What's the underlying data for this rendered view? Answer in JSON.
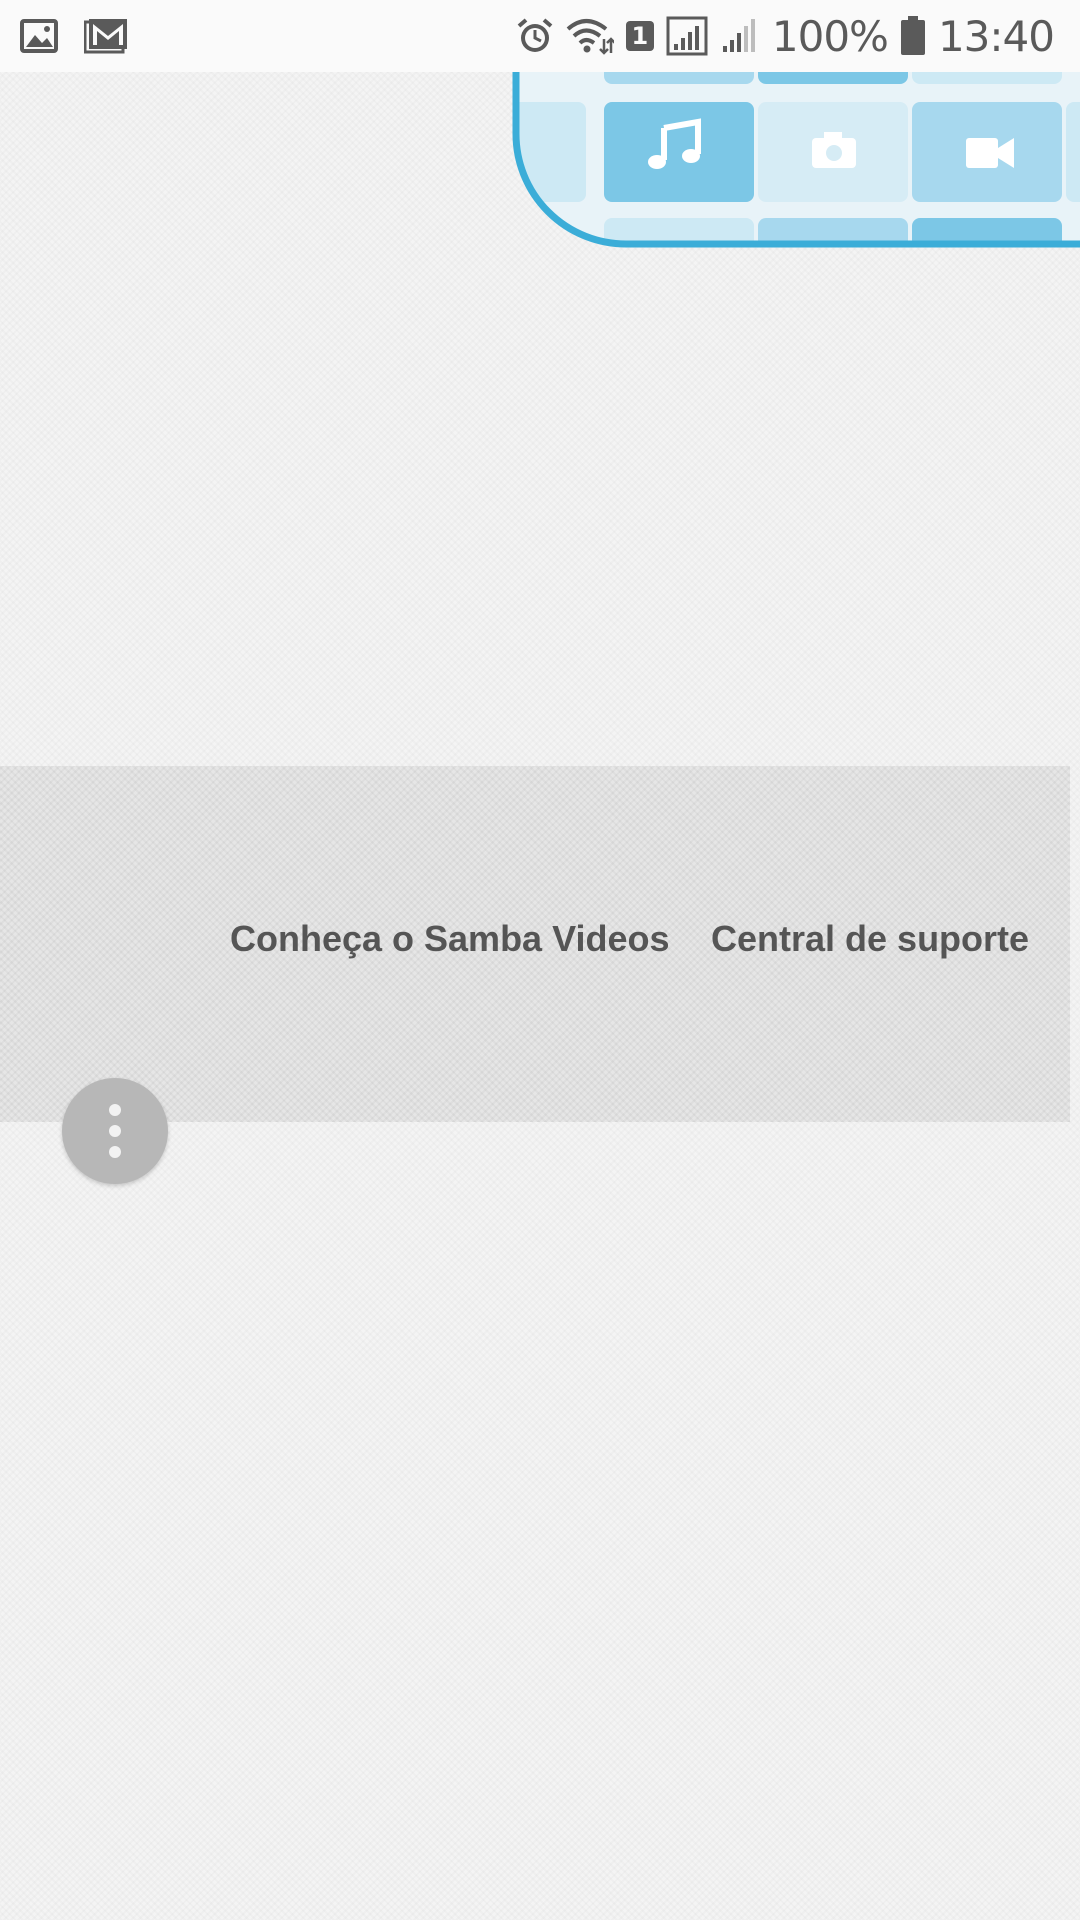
{
  "status_bar": {
    "notification_icons": [
      "gallery-icon",
      "gmail-icon"
    ],
    "system_icons": [
      "alarm-icon",
      "wifi-icon",
      "sim-1-icon",
      "signal-icon",
      "signal-weak-icon",
      "battery-icon"
    ],
    "sim_number": "1",
    "battery_percent": "100%",
    "time": "13:40"
  },
  "hero": {
    "graphic_icons": [
      "music-note-icon",
      "camera-icon",
      "video-camera-icon"
    ],
    "accent_color": "#3badd8",
    "tile_colors": [
      "#7cc7e6",
      "#a7d8ee",
      "#cde9f4"
    ]
  },
  "footer": {
    "links": [
      {
        "label": "Conheça o Samba Videos"
      },
      {
        "label": "Central de suporte"
      }
    ]
  },
  "fab": {
    "icon": "more-vert-icon",
    "color": "#b7b7b7"
  }
}
